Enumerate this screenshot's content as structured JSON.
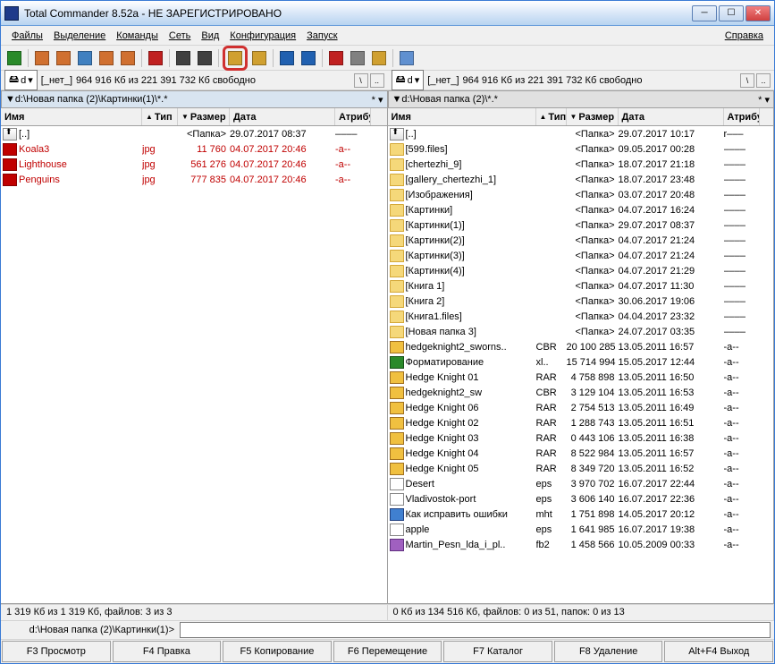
{
  "title": "Total Commander 8.52a - НЕ ЗАРЕГИСТРИРОВАНО",
  "menu": [
    "Файлы",
    "Выделение",
    "Команды",
    "Сеть",
    "Вид",
    "Конфигурация",
    "Запуск"
  ],
  "menu_right": "Справка",
  "drive": {
    "letter": "d",
    "label": "[_нет_]",
    "free": "964 916 Кб из 221 391 732 Кб свободно"
  },
  "left": {
    "path": "▼d:\\Новая папка (2)\\Картинки(1)\\*.*",
    "cols": {
      "name": "Имя",
      "ext": "Тип",
      "size": "Размер",
      "date": "Дата",
      "attr": "Атрибу"
    },
    "cw": {
      "name": 158,
      "ext": 40,
      "size": 58,
      "date": 118,
      "attr": 40
    },
    "rows": [
      {
        "icon": "up",
        "name": "[..]",
        "ext": "",
        "size": "<Папка>",
        "date": "29.07.2017 08:37",
        "attr": "––––",
        "sel": false
      },
      {
        "icon": "jpg",
        "name": "Koala3",
        "ext": "jpg",
        "size": "11 760",
        "date": "04.07.2017 20:46",
        "attr": "-a--",
        "sel": true
      },
      {
        "icon": "jpg",
        "name": "Lighthouse",
        "ext": "jpg",
        "size": "561 276",
        "date": "04.07.2017 20:46",
        "attr": "-a--",
        "sel": true
      },
      {
        "icon": "jpg",
        "name": "Penguins",
        "ext": "jpg",
        "size": "777 835",
        "date": "04.07.2017 20:46",
        "attr": "-a--",
        "sel": true
      }
    ],
    "status": "1 319 Кб из 1 319 Кб, файлов: 3 из 3"
  },
  "right": {
    "path": "▼d:\\Новая папка (2)\\*.*",
    "cols": {
      "name": "Имя",
      "ext": "Тип",
      "size": "Размер",
      "date": "Дата",
      "attr": "Атрибу"
    },
    "cw": {
      "name": 166,
      "ext": 34,
      "size": 58,
      "date": 118,
      "attr": 40
    },
    "rows": [
      {
        "icon": "up",
        "name": "[..]",
        "ext": "",
        "size": "<Папка>",
        "date": "29.07.2017 10:17",
        "attr": "r–––"
      },
      {
        "icon": "folder",
        "name": "[599.files]",
        "ext": "",
        "size": "<Папка>",
        "date": "09.05.2017 00:28",
        "attr": "––––"
      },
      {
        "icon": "folder",
        "name": "[chertezhi_9]",
        "ext": "",
        "size": "<Папка>",
        "date": "18.07.2017 21:18",
        "attr": "––––"
      },
      {
        "icon": "folder",
        "name": "[gallery_chertezhi_1]",
        "ext": "",
        "size": "<Папка>",
        "date": "18.07.2017 23:48",
        "attr": "––––"
      },
      {
        "icon": "folder",
        "name": "[Изображения]",
        "ext": "",
        "size": "<Папка>",
        "date": "03.07.2017 20:48",
        "attr": "––––"
      },
      {
        "icon": "folder",
        "name": "[Картинки]",
        "ext": "",
        "size": "<Папка>",
        "date": "04.07.2017 16:24",
        "attr": "––––"
      },
      {
        "icon": "folder",
        "name": "[Картинки(1)]",
        "ext": "",
        "size": "<Папка>",
        "date": "29.07.2017 08:37",
        "attr": "––––"
      },
      {
        "icon": "folder",
        "name": "[Картинки(2)]",
        "ext": "",
        "size": "<Папка>",
        "date": "04.07.2017 21:24",
        "attr": "––––"
      },
      {
        "icon": "folder",
        "name": "[Картинки(3)]",
        "ext": "",
        "size": "<Папка>",
        "date": "04.07.2017 21:24",
        "attr": "––––"
      },
      {
        "icon": "folder",
        "name": "[Картинки(4)]",
        "ext": "",
        "size": "<Папка>",
        "date": "04.07.2017 21:29",
        "attr": "––––"
      },
      {
        "icon": "folder",
        "name": "[Книга 1]",
        "ext": "",
        "size": "<Папка>",
        "date": "04.07.2017 11:30",
        "attr": "––––"
      },
      {
        "icon": "folder",
        "name": "[Книга 2]",
        "ext": "",
        "size": "<Папка>",
        "date": "30.06.2017 19:06",
        "attr": "––––"
      },
      {
        "icon": "folder",
        "name": "[Книга1.files]",
        "ext": "",
        "size": "<Папка>",
        "date": "04.04.2017 23:32",
        "attr": "––––"
      },
      {
        "icon": "folder",
        "name": "[Новая папка 3]",
        "ext": "",
        "size": "<Папка>",
        "date": "24.07.2017 03:35",
        "attr": "––––"
      },
      {
        "icon": "archive",
        "name": "hedgeknight2_sworns..",
        "ext": "CBR",
        "size": "20 100 285",
        "date": "13.05.2011 16:57",
        "attr": "-a--"
      },
      {
        "icon": "xls",
        "name": "Форматирование",
        "ext": "xl..",
        "size": "15 714 994",
        "date": "15.05.2017 12:44",
        "attr": "-a--"
      },
      {
        "icon": "archive",
        "name": "Hedge Knight 01",
        "ext": "RAR",
        "size": "4 758 898",
        "date": "13.05.2011 16:50",
        "attr": "-a--"
      },
      {
        "icon": "archive",
        "name": "hedgeknight2_sw",
        "ext": "CBR",
        "size": "3 129 104",
        "date": "13.05.2011 16:53",
        "attr": "-a--"
      },
      {
        "icon": "archive",
        "name": "Hedge Knight 06",
        "ext": "RAR",
        "size": "2 754 513",
        "date": "13.05.2011 16:49",
        "attr": "-a--"
      },
      {
        "icon": "archive",
        "name": "Hedge Knight 02",
        "ext": "RAR",
        "size": "1 288 743",
        "date": "13.05.2011 16:51",
        "attr": "-a--"
      },
      {
        "icon": "archive",
        "name": "Hedge Knight 03",
        "ext": "RAR",
        "size": "0 443 106",
        "date": "13.05.2011 16:38",
        "attr": "-a--"
      },
      {
        "icon": "archive",
        "name": "Hedge Knight 04",
        "ext": "RAR",
        "size": "8 522 984",
        "date": "13.05.2011 16:57",
        "attr": "-a--"
      },
      {
        "icon": "archive",
        "name": "Hedge Knight 05",
        "ext": "RAR",
        "size": "8 349 720",
        "date": "13.05.2011 16:52",
        "attr": "-a--"
      },
      {
        "icon": "file",
        "name": "Desert",
        "ext": "eps",
        "size": "3 970 702",
        "date": "16.07.2017 22:44",
        "attr": "-a--"
      },
      {
        "icon": "file",
        "name": "Vladivostok-port",
        "ext": "eps",
        "size": "3 606 140",
        "date": "16.07.2017 22:36",
        "attr": "-a--"
      },
      {
        "icon": "mht",
        "name": "Как исправить ошибки",
        "ext": "mht",
        "size": "1 751 898",
        "date": "14.05.2017 20:12",
        "attr": "-a--"
      },
      {
        "icon": "file",
        "name": "apple",
        "ext": "eps",
        "size": "1 641 985",
        "date": "16.07.2017 19:38",
        "attr": "-a--"
      },
      {
        "icon": "fb2",
        "name": "Martin_Pesn_lda_i_pl..",
        "ext": "fb2",
        "size": "1 458 566",
        "date": "10.05.2009 00:33",
        "attr": "-a--"
      }
    ],
    "status": "0 Кб из 134 516 Кб, файлов: 0 из 51, папок: 0 из 13"
  },
  "cmdpath": "d:\\Новая папка (2)\\Картинки(1)>",
  "fkeys": [
    "F3 Просмотр",
    "F4 Правка",
    "F5 Копирование",
    "F6 Перемещение",
    "F7 Каталог",
    "F8 Удаление",
    "Alt+F4 Выход"
  ],
  "toolbar_icons": [
    "refresh",
    "tree-brief",
    "tree-full",
    "thumbs",
    "tree-toggle",
    "tree-sync",
    "invert",
    "back",
    "forward",
    "pack",
    "unpack",
    "ftp",
    "url",
    "target",
    "compare",
    "sync",
    "notepad"
  ]
}
